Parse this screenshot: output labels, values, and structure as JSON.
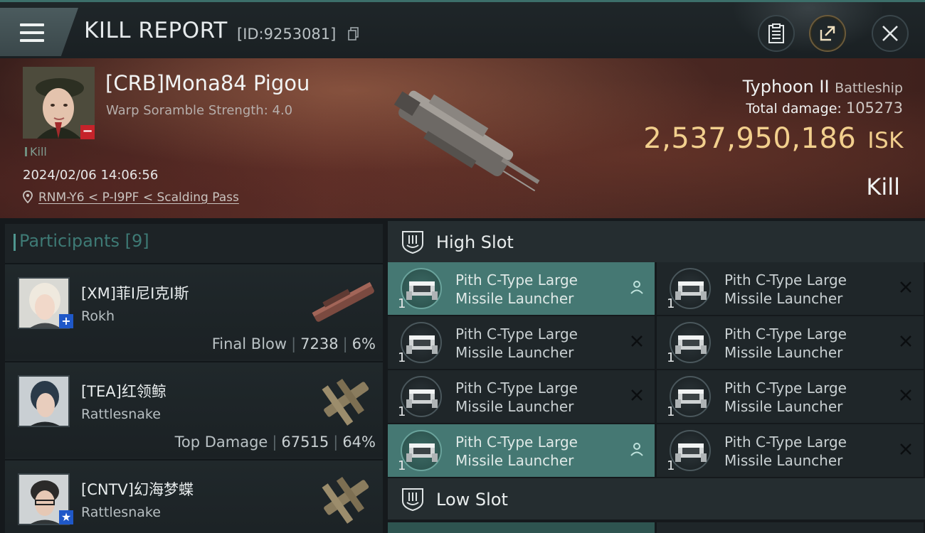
{
  "header": {
    "title": "KILL REPORT",
    "report_id": "[ID:9253081]"
  },
  "victim": {
    "name": "[CRB]Mona84 Pigou",
    "scramble": "Warp Soramble Strength: 4.0",
    "tag": "Kill",
    "timestamp": "2024/02/06 14:06:56",
    "location": "RNM-Y6 < P-I9PF < Scalding Pass",
    "ship": "Typhoon II",
    "ship_class": "Battleship",
    "damage_label": "Total damage:",
    "damage_value": "105273",
    "isk_value": "2,537,950,186",
    "isk_unit": "ISK",
    "result": "Kill"
  },
  "participants": {
    "title": "Participants [9]",
    "rows": [
      {
        "name": "[XM]菲I尼I克I斯",
        "ship": "Rokh",
        "stat_label": "Final Blow",
        "damage": "7238",
        "percent": "6%",
        "badge": "+"
      },
      {
        "name": "[TEA]红领鲸",
        "ship": "Rattlesnake",
        "stat_label": "Top Damage",
        "damage": "67515",
        "percent": "64%",
        "badge": ""
      },
      {
        "name": "[CNTV]幻海梦蝶",
        "ship": "Rattlesnake",
        "stat_label": "",
        "damage": "",
        "percent": "",
        "badge": "★"
      }
    ]
  },
  "slots": {
    "high_label": "High Slot",
    "low_label": "Low Slot",
    "high_modules": [
      {
        "line1": "Pith C-Type Large",
        "line2": "Missile Launcher",
        "qty": "1",
        "state": "person-icon",
        "active": true
      },
      {
        "line1": "Pith C-Type Large",
        "line2": "Missile Launcher",
        "qty": "1",
        "state": "x-icon",
        "active": false
      },
      {
        "line1": "Pith C-Type Large",
        "line2": "Missile Launcher",
        "qty": "1",
        "state": "x-icon",
        "active": false
      },
      {
        "line1": "Pith C-Type Large",
        "line2": "Missile Launcher",
        "qty": "1",
        "state": "person-icon",
        "active": true
      },
      {
        "line1": "Pith C-Type Large",
        "line2": "Missile Launcher",
        "qty": "1",
        "state": "x-icon",
        "active": false
      },
      {
        "line1": "Pith C-Type Large",
        "line2": "Missile Launcher",
        "qty": "1",
        "state": "x-icon",
        "active": false
      },
      {
        "line1": "Pith C-Type Large",
        "line2": "Missile Launcher",
        "qty": "1",
        "state": "x-icon",
        "active": false
      },
      {
        "line1": "Pith C-Type Large",
        "line2": "Missile Launcher",
        "qty": "1",
        "state": "x-icon",
        "active": false
      }
    ]
  },
  "colors": {
    "accent_teal": "#457873",
    "isk_gold": "#f2cf8d",
    "badge_red": "#c5232a",
    "badge_blue": "#1f58c8"
  }
}
